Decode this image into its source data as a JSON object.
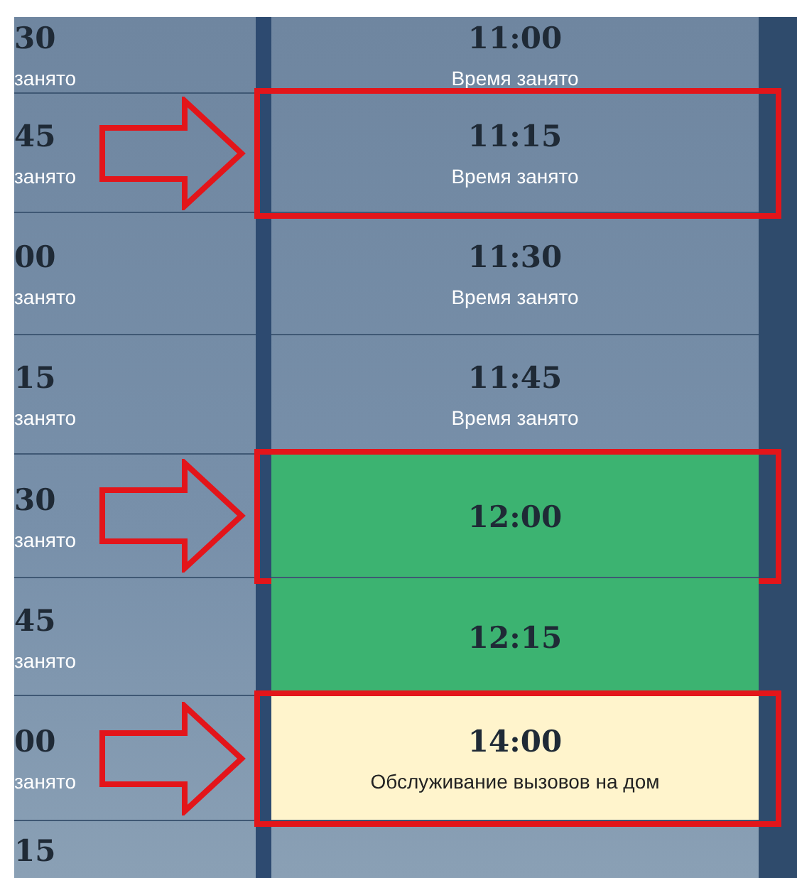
{
  "rows": [
    {
      "left": {
        "time": "30",
        "label": "занято"
      },
      "slot": {
        "kind": "busy",
        "time": "11:00",
        "label": "Время занято",
        "marked": false
      }
    },
    {
      "left": {
        "time": "45",
        "label": "занято"
      },
      "slot": {
        "kind": "busy",
        "time": "11:15",
        "label": "Время занято",
        "marked": true
      }
    },
    {
      "left": {
        "time": "00",
        "label": "занято"
      },
      "slot": {
        "kind": "busy",
        "time": "11:30",
        "label": "Время занято",
        "marked": false
      }
    },
    {
      "left": {
        "time": "15",
        "label": "занято"
      },
      "slot": {
        "kind": "busy",
        "time": "11:45",
        "label": "Время занято",
        "marked": false
      }
    },
    {
      "left": {
        "time": "30",
        "label": "занято"
      },
      "slot": {
        "kind": "free",
        "time": "12:00",
        "marked": true
      }
    },
    {
      "left": {
        "time": "45",
        "label": "занято"
      },
      "slot": {
        "kind": "free",
        "time": "12:15",
        "marked": false
      }
    },
    {
      "left": {
        "time": "00",
        "label": "занято"
      },
      "slot": {
        "kind": "house_call",
        "time": "14:00",
        "label": "Обслуживание вызовов на дом",
        "marked": true
      }
    },
    {
      "left": {
        "time": "15"
      }
    }
  ]
}
